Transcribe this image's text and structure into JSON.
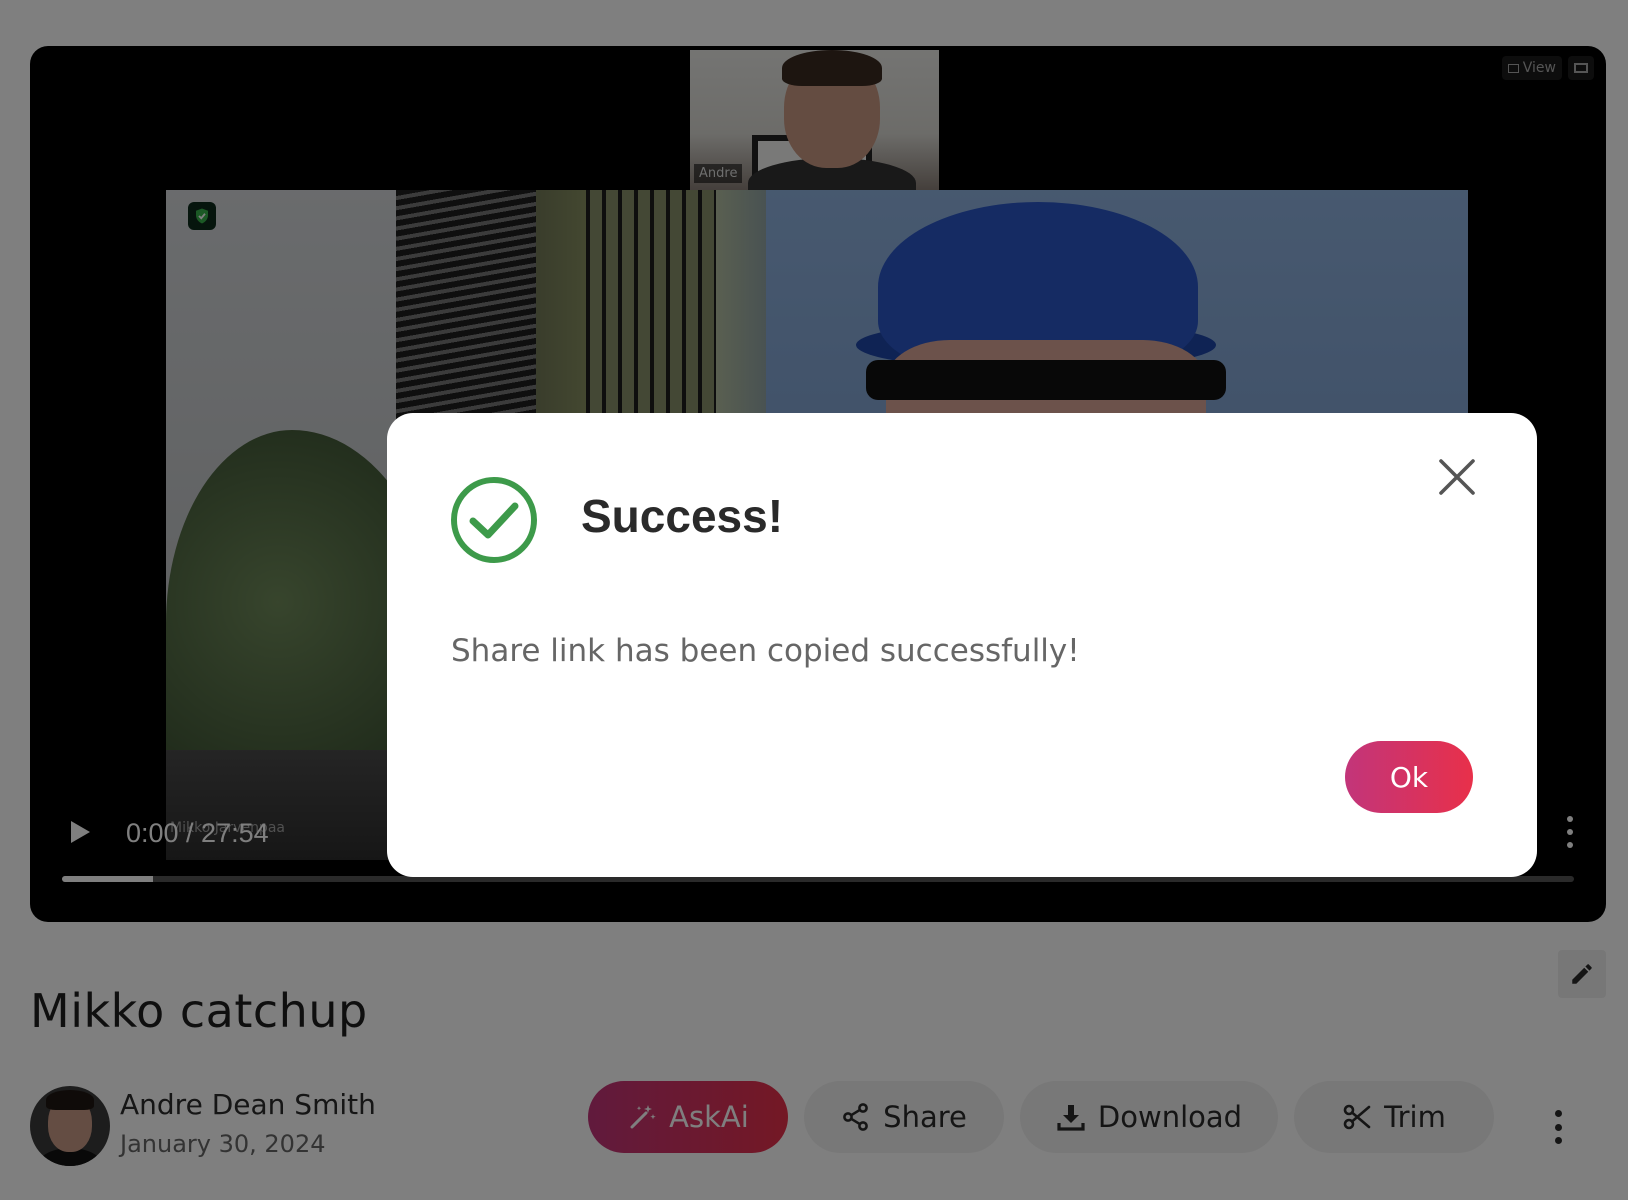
{
  "video": {
    "time_display": "0:00 / 27:54",
    "progress_fraction": 0.06,
    "view_label": "View",
    "participant_top": "Andre",
    "participant_main": "Mikko Jarvenpaa"
  },
  "recording": {
    "title": "Mikko catchup",
    "author_name": "Andre Dean Smith",
    "date": "January 30, 2024"
  },
  "actions": {
    "askai_label": "AskAi",
    "share_label": "Share",
    "download_label": "Download",
    "trim_label": "Trim"
  },
  "dialog": {
    "title": "Success!",
    "message": "Share link has been copied successfully!",
    "ok_label": "Ok"
  },
  "colors": {
    "accent_start": "#c2357a",
    "accent_end": "#e8304a",
    "success_green": "#3d9a4a"
  }
}
